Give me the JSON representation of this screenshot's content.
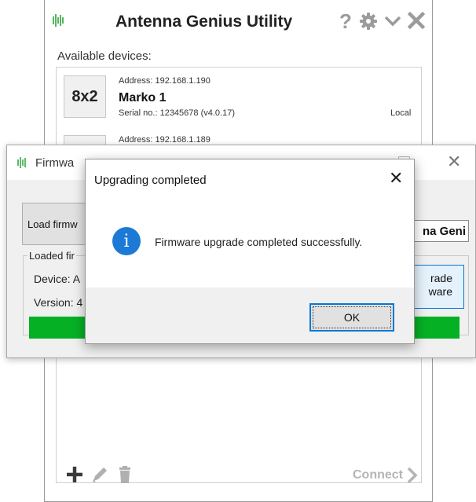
{
  "main_window": {
    "title": "Antenna Genius Utility",
    "available_label": "Available devices:",
    "devices": [
      {
        "badge": "8x2",
        "address": "Address: 192.168.1.190",
        "name": "Marko 1",
        "serial": "Serial no.: 12345678 (v4.0.17)",
        "tag": "Local"
      },
      {
        "address": "Address: 192.168.1.189"
      }
    ],
    "connect_label": "Connect",
    "icons": {
      "help": "question-mark-icon",
      "settings": "gear-icon",
      "collapse": "chevron-down-icon",
      "close": "close-icon",
      "add": "plus-icon",
      "edit": "pencil-icon",
      "delete": "trash-icon",
      "connect": "chevron-right-icon"
    }
  },
  "firmware_window": {
    "title": "Firmwa",
    "load_button": "Load firmw",
    "name_field_value": "na Geni",
    "loaded_group_label": "Loaded fir",
    "device_label": "Device: A",
    "version_label": "Version: 4",
    "upgrade_button_line1": "rade",
    "upgrade_button_line2": "ware",
    "progress_value": 1.0,
    "progress_color": "#06b025"
  },
  "dialog": {
    "title": "Upgrading completed",
    "message": "Firmware upgrade completed successfully.",
    "ok_label": "OK",
    "info_icon_glyph": "i",
    "accent": "#1c7ad6"
  },
  "colors": {
    "brand_green": "#2aa33a",
    "focus_blue": "#0078d7"
  }
}
